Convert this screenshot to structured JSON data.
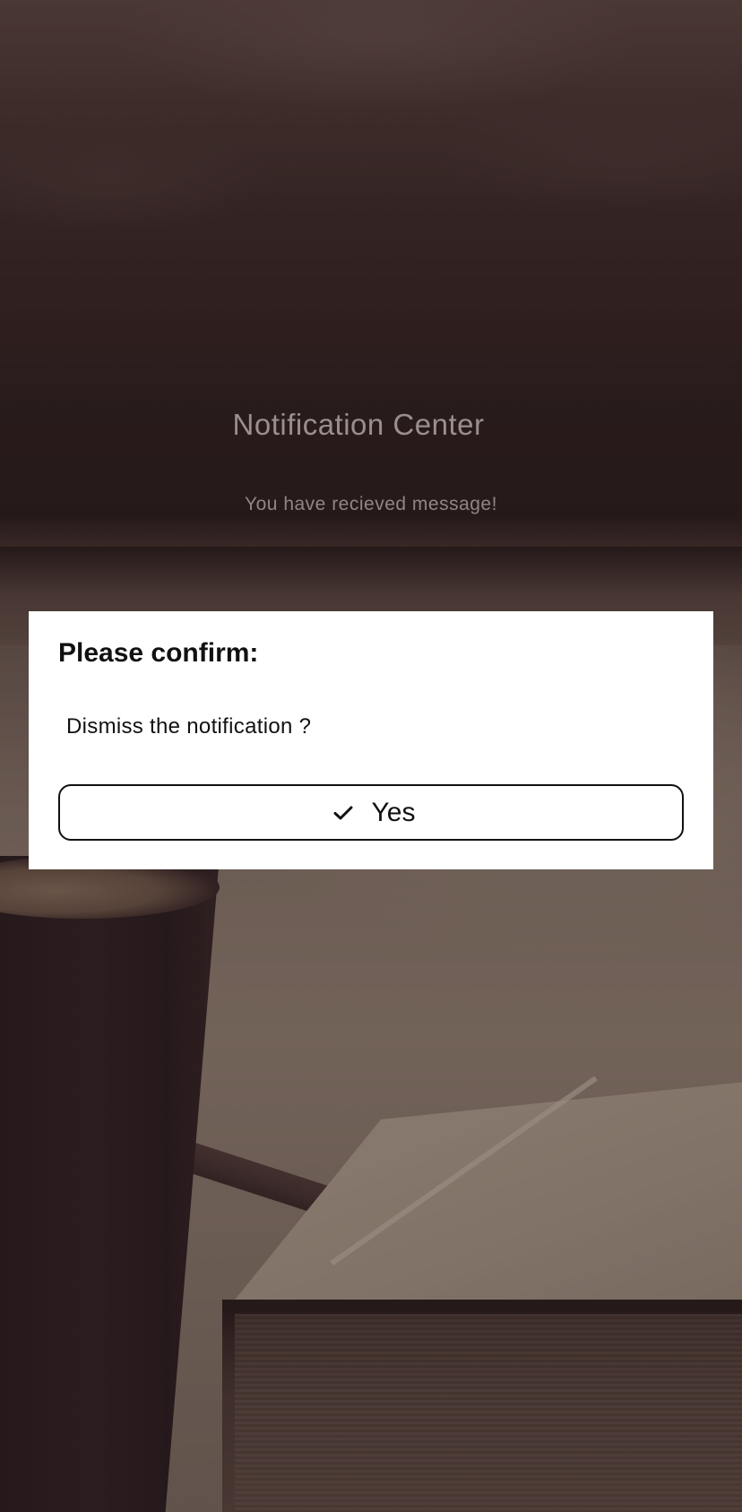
{
  "page": {
    "title": "Notification Center",
    "message": "You have recieved message!"
  },
  "dialog": {
    "title": "Please confirm:",
    "body": "Dismiss the notification ?",
    "confirm_button": {
      "label": "Yes",
      "icon": "check-icon"
    }
  },
  "colors": {
    "dialog_background": "#ffffff",
    "button_border": "#111111",
    "page_text": "#9a8f8f"
  }
}
